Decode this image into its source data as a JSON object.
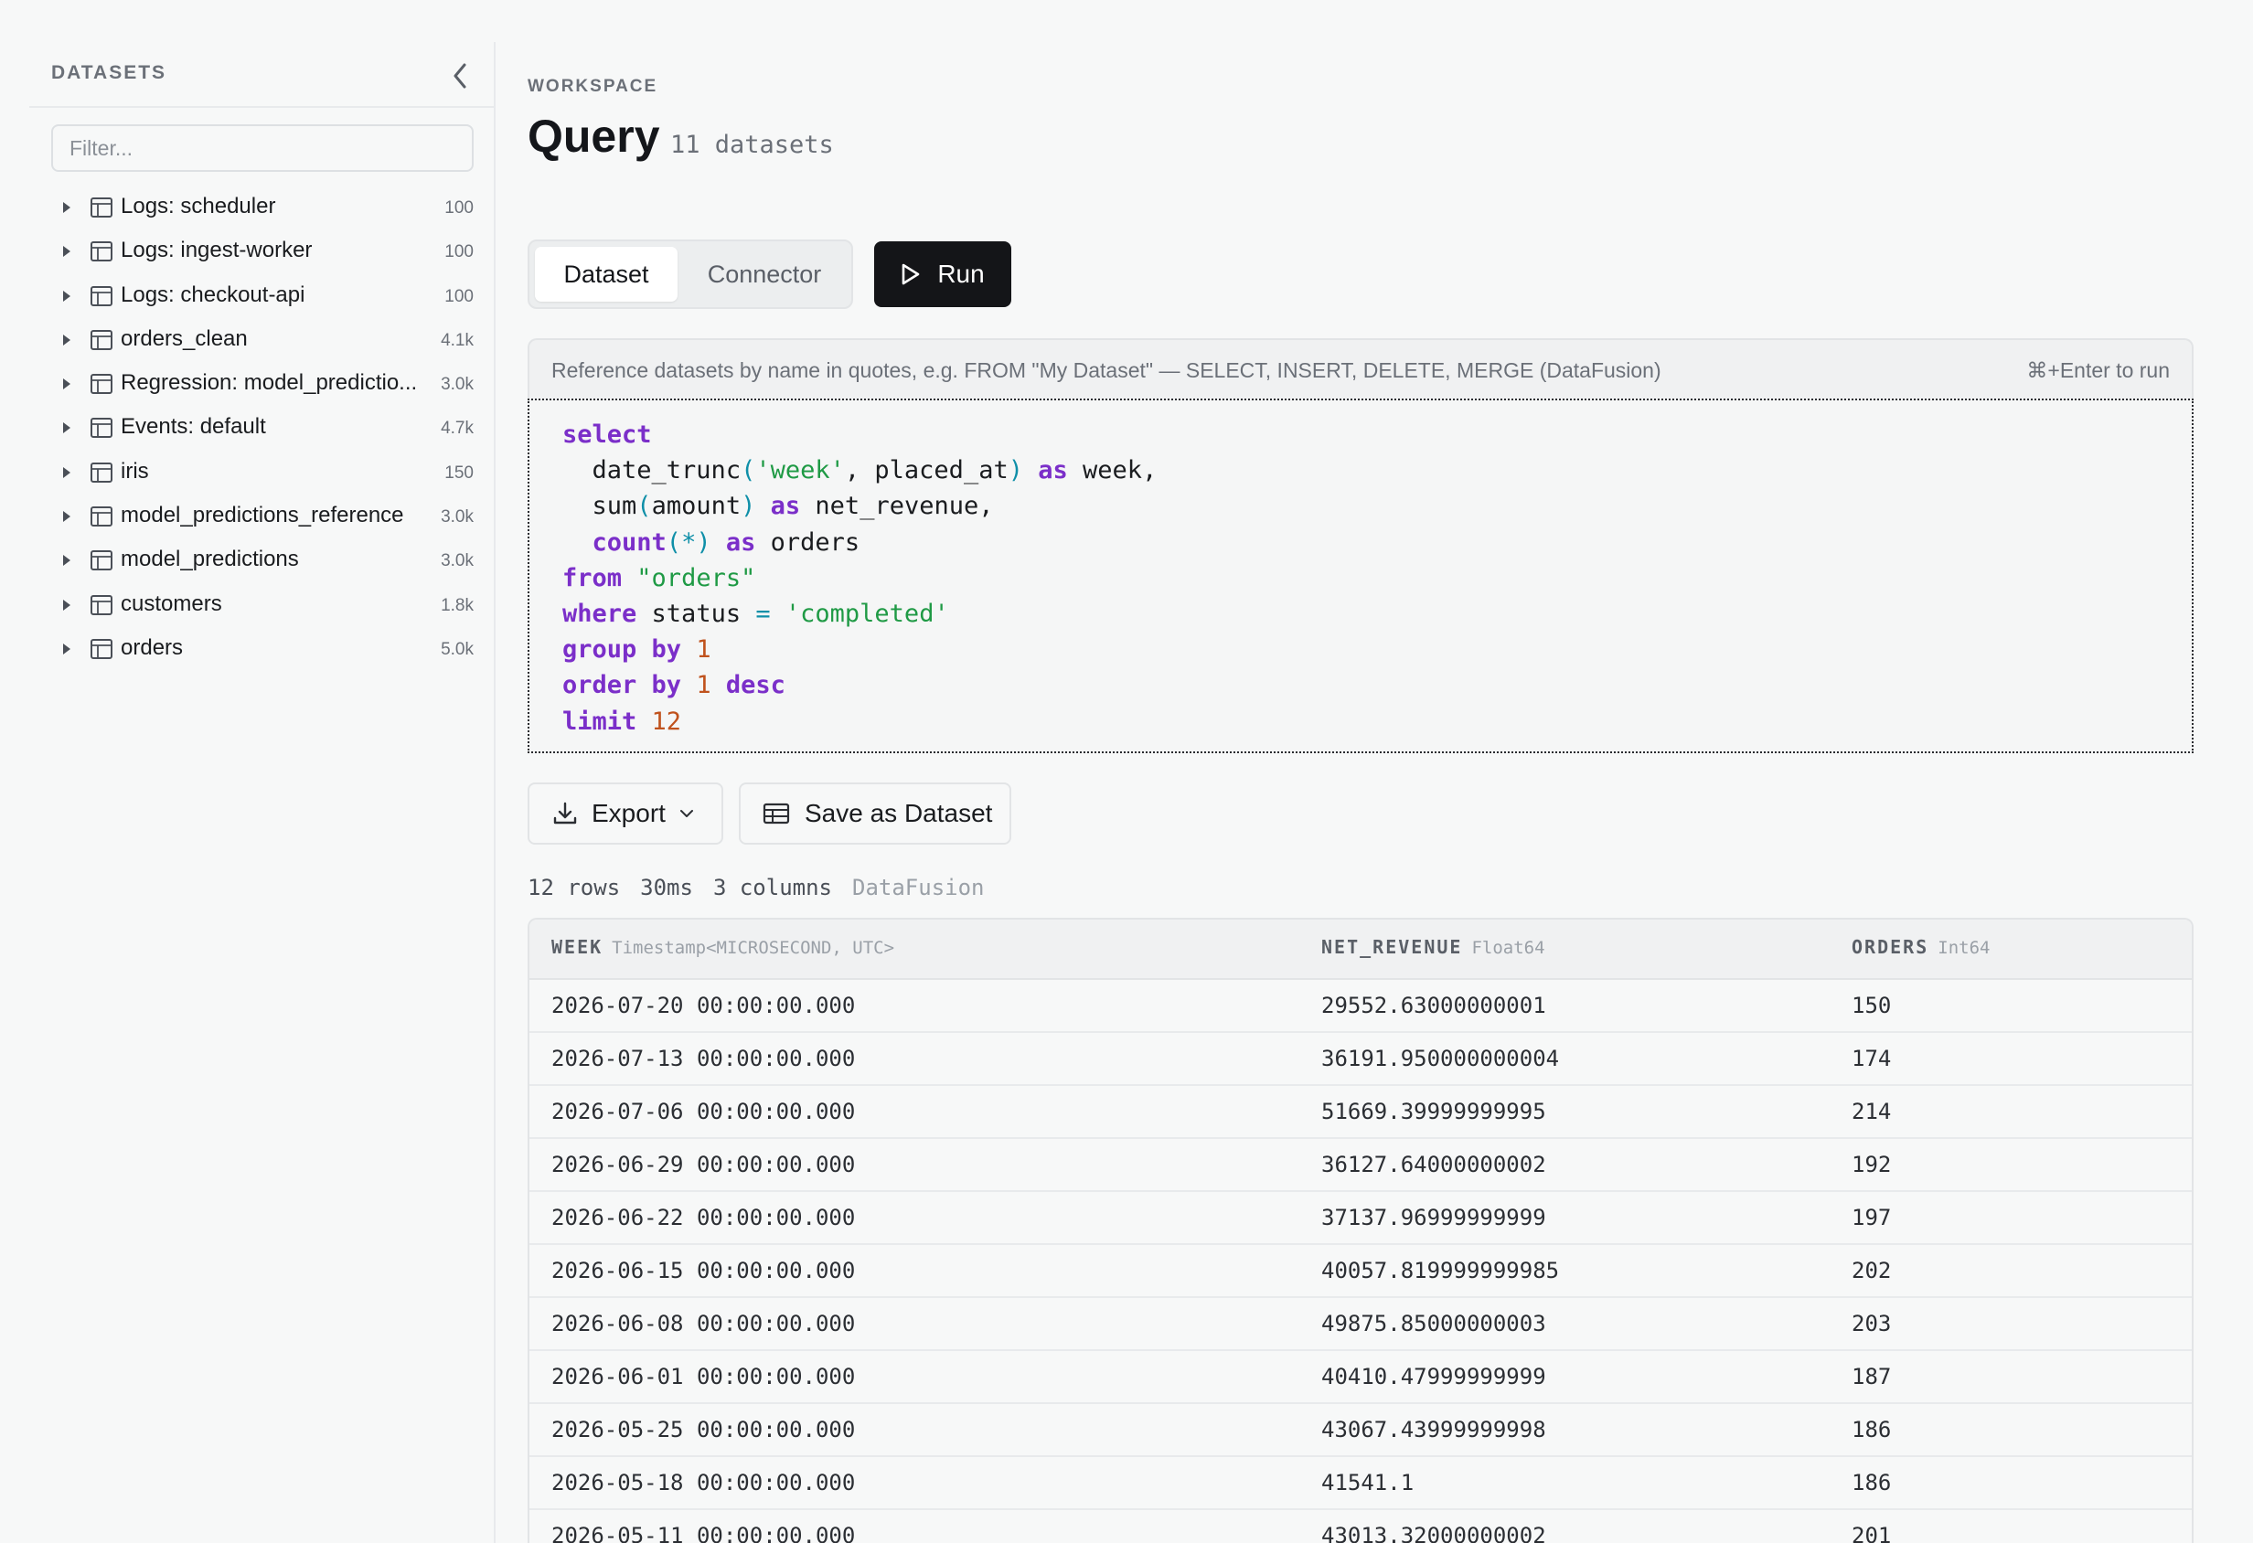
{
  "sidebar": {
    "title": "DATASETS",
    "filter_placeholder": "Filter...",
    "items": [
      {
        "label": "Logs: scheduler",
        "count": "100"
      },
      {
        "label": "Logs: ingest-worker",
        "count": "100"
      },
      {
        "label": "Logs: checkout-api",
        "count": "100"
      },
      {
        "label": "orders_clean",
        "count": "4.1k"
      },
      {
        "label": "Regression: model_predictio...",
        "count": "3.0k"
      },
      {
        "label": "Events: default",
        "count": "4.7k"
      },
      {
        "label": "iris",
        "count": "150"
      },
      {
        "label": "model_predictions_reference",
        "count": "3.0k"
      },
      {
        "label": "model_predictions",
        "count": "3.0k"
      },
      {
        "label": "customers",
        "count": "1.8k"
      },
      {
        "label": "orders",
        "count": "5.0k"
      }
    ]
  },
  "header": {
    "eyebrow": "WORKSPACE",
    "title": "Query",
    "dataset_count": "11 datasets"
  },
  "tabs": {
    "dataset": "Dataset",
    "connector": "Connector",
    "active": "Dataset"
  },
  "run_label": "Run",
  "editor": {
    "hint": "Reference datasets by name in quotes, e.g. FROM \"My Dataset\" — SELECT, INSERT, DELETE, MERGE (DataFusion)",
    "shortcut": "⌘+Enter to run",
    "tokens": {
      "select": "select",
      "date_trunc": "date_trunc",
      "week_str": "'week'",
      "placed_at": "placed_at",
      "as": "as",
      "week": "week",
      "sum": "sum",
      "amount": "amount",
      "net_revenue": "net_revenue",
      "count": "count",
      "star": "*",
      "orders": "orders",
      "from": "from",
      "orders_ref": "\"orders\"",
      "where": "where",
      "status": "status",
      "eq": "=",
      "completed": "'completed'",
      "group": "group",
      "by": "by",
      "one": "1",
      "order": "order",
      "desc": "desc",
      "limit": "limit",
      "twelve": "12"
    }
  },
  "toolbar": {
    "export_label": "Export",
    "save_label": "Save as Dataset"
  },
  "stats": {
    "rows": "12 rows",
    "time": "30ms",
    "columns": "3 columns",
    "engine": "DataFusion"
  },
  "table": {
    "columns": [
      {
        "name": "WEEK",
        "type": "Timestamp<MICROSECOND, UTC>"
      },
      {
        "name": "NET_REVENUE",
        "type": "Float64"
      },
      {
        "name": "ORDERS",
        "type": "Int64"
      }
    ],
    "rows": [
      [
        "2026-07-20 00:00:00.000",
        "29552.63000000001",
        "150"
      ],
      [
        "2026-07-13 00:00:00.000",
        "36191.950000000004",
        "174"
      ],
      [
        "2026-07-06 00:00:00.000",
        "51669.39999999995",
        "214"
      ],
      [
        "2026-06-29 00:00:00.000",
        "36127.64000000002",
        "192"
      ],
      [
        "2026-06-22 00:00:00.000",
        "37137.96999999999",
        "197"
      ],
      [
        "2026-06-15 00:00:00.000",
        "40057.819999999985",
        "202"
      ],
      [
        "2026-06-08 00:00:00.000",
        "49875.85000000003",
        "203"
      ],
      [
        "2026-06-01 00:00:00.000",
        "40410.47999999999",
        "187"
      ],
      [
        "2026-05-25 00:00:00.000",
        "43067.43999999998",
        "186"
      ],
      [
        "2026-05-18 00:00:00.000",
        "41541.1",
        "186"
      ],
      [
        "2026-05-11 00:00:00.000",
        "43013.32000000002",
        "201"
      ]
    ]
  },
  "icons": {
    "collapse": "chevron-left-icon",
    "caret": "caret-right-icon",
    "dataset": "table-icon",
    "run": "play-icon",
    "export": "download-icon",
    "export_menu": "chevron-down-icon",
    "save": "table-icon"
  }
}
